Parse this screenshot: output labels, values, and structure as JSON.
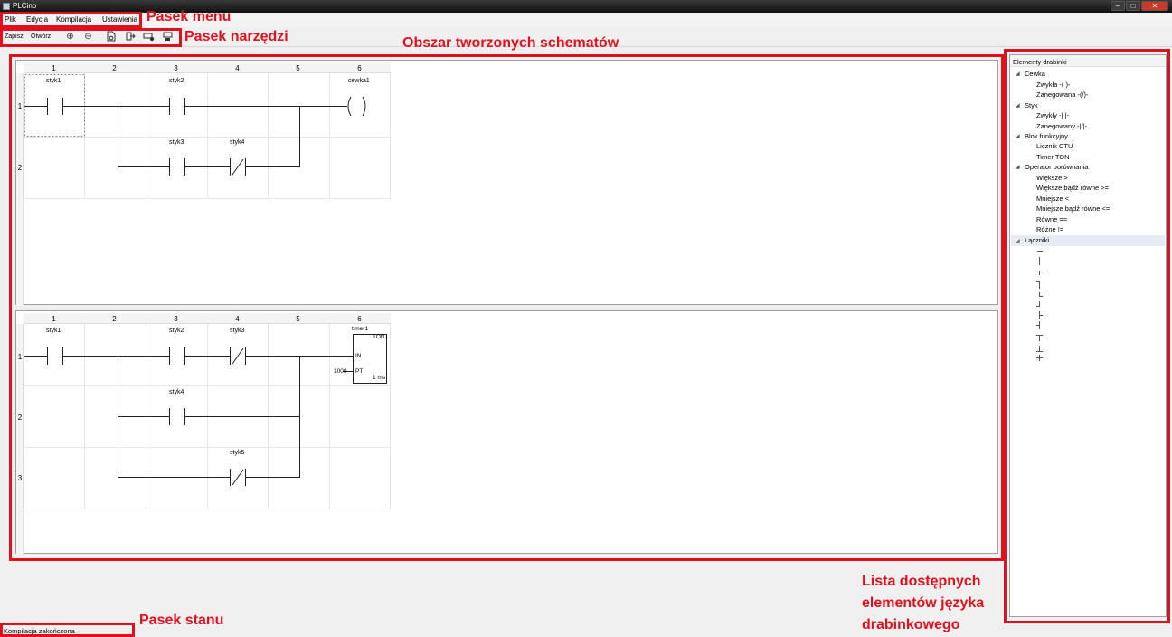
{
  "window": {
    "title": "PLCino"
  },
  "menu": {
    "items": [
      "Plik",
      "Edycja",
      "Kompilacja",
      "Ustawienia"
    ]
  },
  "toolbar": {
    "save_label": "Zapisz",
    "open_label": "Otwórz"
  },
  "annotations": {
    "menu_bar": "Pasek menu",
    "toolbar": "Pasek narzędzi",
    "diagram_area": "Obszar tworzonych schematów",
    "element_list_1": "Lista dostępnych",
    "element_list_2": "elementów języka",
    "element_list_3": "drabinkowego",
    "status_bar": "Pasek stanu"
  },
  "diagram1": {
    "columns": [
      "1",
      "2",
      "3",
      "4",
      "5",
      "6"
    ],
    "rows": [
      "1",
      "2"
    ],
    "labels": {
      "c1": "styk1",
      "c2": "styk2",
      "coil": "cewka1",
      "c3": "styk3",
      "c4": "styk4"
    }
  },
  "diagram2": {
    "columns": [
      "1",
      "2",
      "3",
      "4",
      "5",
      "6"
    ],
    "rows": [
      "1",
      "2",
      "3"
    ],
    "labels": {
      "c1": "styk1",
      "c2": "styk2",
      "c3": "styk3",
      "timer": "timer1",
      "c4": "styk4",
      "c5": "styk5"
    },
    "timer_block": {
      "type": "TON",
      "in": "IN",
      "pt": "PT",
      "preset": "1000",
      "value": "1 ms"
    }
  },
  "elements_panel": {
    "header": "Elementy drabinki",
    "groups": [
      {
        "label": "Cewka",
        "items": [
          "Zwykła -( )-",
          "Zanegowana -(/)-"
        ]
      },
      {
        "label": "Styk",
        "items": [
          "Zwykły -| |-",
          "Zanegowany -|/|-"
        ]
      },
      {
        "label": "Blok funkcyjny",
        "items": [
          "Licznik CTU",
          "Timer TON"
        ]
      },
      {
        "label": "Operator porównania",
        "items": [
          "Większe >",
          "Większe bądź równe >=",
          "Mniejsze <",
          "Mniejsze bądź równe <=",
          "Równe ==",
          "Różne !="
        ]
      },
      {
        "label": "Łączniki",
        "items": []
      }
    ]
  },
  "status": {
    "text": "Kompilacja zakończona"
  }
}
